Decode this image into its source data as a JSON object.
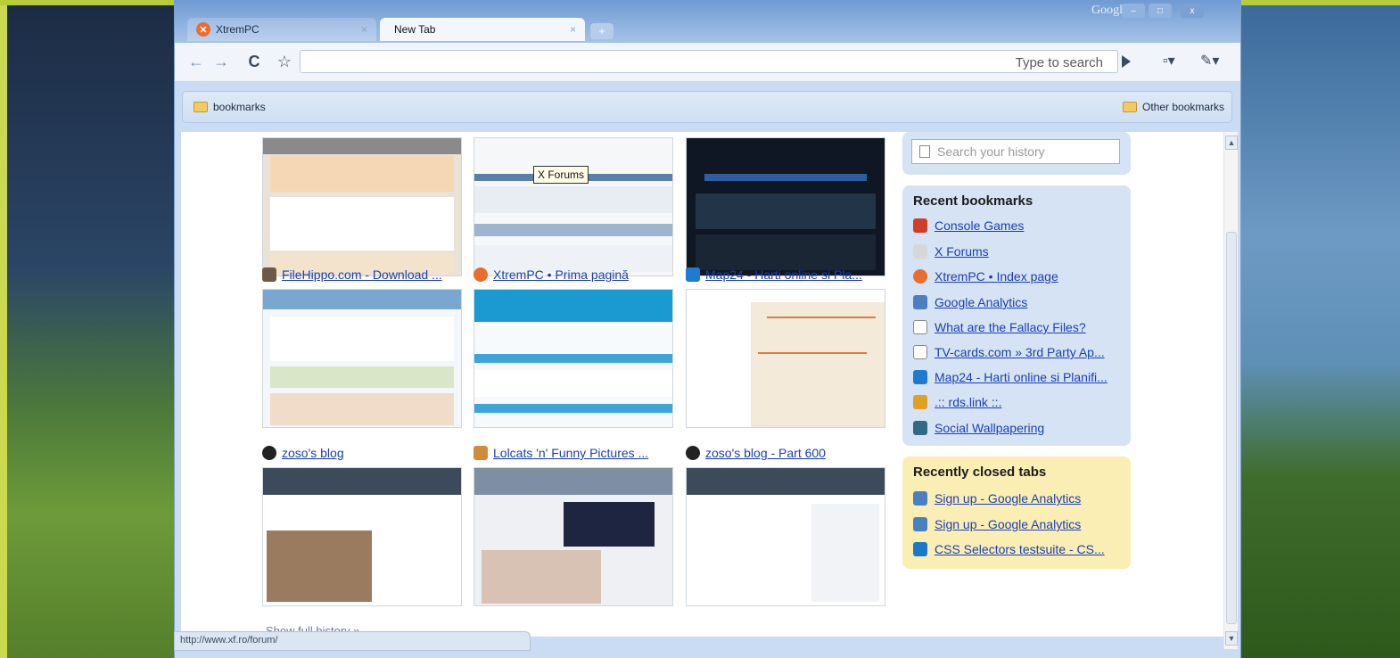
{
  "window": {
    "brand": "Google",
    "controls": [
      "–",
      "□",
      "x"
    ]
  },
  "tabs": [
    {
      "label": "XtremPC",
      "close": "×"
    },
    {
      "label": "New Tab",
      "close": "×"
    }
  ],
  "toolbar": {
    "back": "←",
    "forward": "→",
    "reload": "C",
    "star": "☆",
    "address_placeholder": "Type to search",
    "page_menu": "▫▾",
    "wrench_menu": "✎▾"
  },
  "bookmarks_bar": {
    "left": "bookmarks",
    "right": "Other bookmarks"
  },
  "tooltip": "X Forums",
  "thumbnails": [
    {
      "title": ""
    },
    {
      "title": ""
    },
    {
      "title": ""
    },
    {
      "title": "FileHippo.com - Download ..."
    },
    {
      "title": "XtremPC • Prima pagină"
    },
    {
      "title": "Map24 - Harti online si Pla..."
    },
    {
      "title": "zoso's blog"
    },
    {
      "title": "Lolcats 'n' Funny Pictures ..."
    },
    {
      "title": "zoso's blog - Part 600"
    }
  ],
  "history_search": {
    "placeholder": "Search your history"
  },
  "recent_bookmarks": {
    "heading": "Recent bookmarks",
    "items": [
      {
        "label": "Console Games",
        "icon": "cg-icon",
        "color": "#d23d2a"
      },
      {
        "label": "X Forums",
        "icon": "x-forums-icon",
        "color": "#d7d7d7"
      },
      {
        "label": "XtremPC • Index page",
        "icon": "xtrempc-icon",
        "color": "#e86d2e"
      },
      {
        "label": "Google Analytics",
        "icon": "analytics-icon",
        "color": "#4a7fc1"
      },
      {
        "label": "What are the Fallacy Files?",
        "icon": "page-icon",
        "color": "#ffffff"
      },
      {
        "label": "TV-cards.com » 3rd Party Ap...",
        "icon": "page-icon",
        "color": "#ffffff"
      },
      {
        "label": "Map24 - Harti online si Planifi...",
        "icon": "map24-icon",
        "color": "#1f7ad1"
      },
      {
        "label": ".:: rds.link ::.",
        "icon": "rds-icon",
        "color": "#e0a020"
      },
      {
        "label": "Social Wallpapering",
        "icon": "social-icon",
        "color": "#2f6a82"
      }
    ]
  },
  "recently_closed": {
    "heading": "Recently closed tabs",
    "items": [
      {
        "label": "Sign up - Google Analytics",
        "icon": "analytics-icon",
        "color": "#4a7fc1"
      },
      {
        "label": "Sign up - Google Analytics",
        "icon": "analytics-icon",
        "color": "#4a7fc1"
      },
      {
        "label": "CSS Selectors testsuite - CS...",
        "icon": "css3-icon",
        "color": "#1c79c9"
      }
    ]
  },
  "show_history": "Show full history »",
  "status_url": "http://www.xf.ro/forum/",
  "scroll": {
    "up": "▲",
    "down": "▼"
  }
}
